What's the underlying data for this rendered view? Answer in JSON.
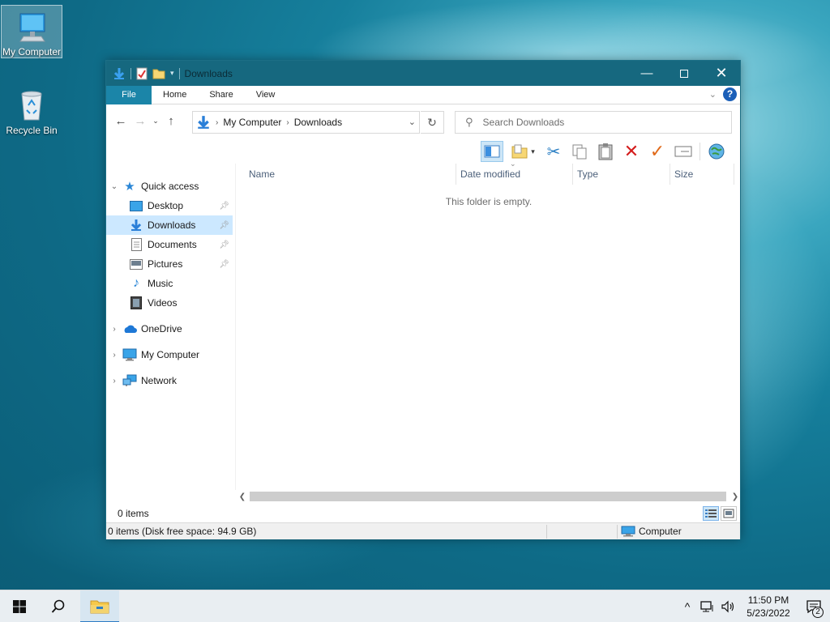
{
  "desktop": {
    "icons": [
      {
        "label": "My Computer",
        "icon": "computer-icon"
      },
      {
        "label": "Recycle Bin",
        "icon": "recycle-bin-icon"
      }
    ]
  },
  "window": {
    "title": "Downloads",
    "ribbon_tabs": [
      "File",
      "Home",
      "Share",
      "View"
    ],
    "help": "?",
    "address": {
      "crumbs": [
        "My Computer",
        "Downloads"
      ]
    },
    "search": {
      "placeholder": "Search Downloads"
    },
    "columns": [
      "Name",
      "Date modified",
      "Type",
      "Size"
    ],
    "empty_message": "This folder is empty.",
    "item_count": "0 items",
    "status_left": "0 items (Disk free space: 94.9 GB)",
    "status_right": "Computer"
  },
  "nav_pane": {
    "quick_access": "Quick access",
    "items": [
      {
        "label": "Desktop",
        "icon": "desktop-icon",
        "pinned": true
      },
      {
        "label": "Downloads",
        "icon": "downloads-icon",
        "pinned": true,
        "selected": true
      },
      {
        "label": "Documents",
        "icon": "documents-icon",
        "pinned": true
      },
      {
        "label": "Pictures",
        "icon": "pictures-icon",
        "pinned": true
      },
      {
        "label": "Music",
        "icon": "music-icon",
        "pinned": false
      },
      {
        "label": "Videos",
        "icon": "videos-icon",
        "pinned": false
      }
    ],
    "roots": [
      {
        "label": "OneDrive",
        "icon": "onedrive-icon"
      },
      {
        "label": "My Computer",
        "icon": "computer-icon"
      },
      {
        "label": "Network",
        "icon": "network-icon"
      }
    ]
  },
  "taskbar": {
    "time": "11:50 PM",
    "date": "5/23/2022",
    "notification_count": "2"
  },
  "colors": {
    "titlebar": "#16687f",
    "file_tab": "#1b85a8",
    "selection": "#cce8ff",
    "taskbar": "#e9eef2"
  }
}
